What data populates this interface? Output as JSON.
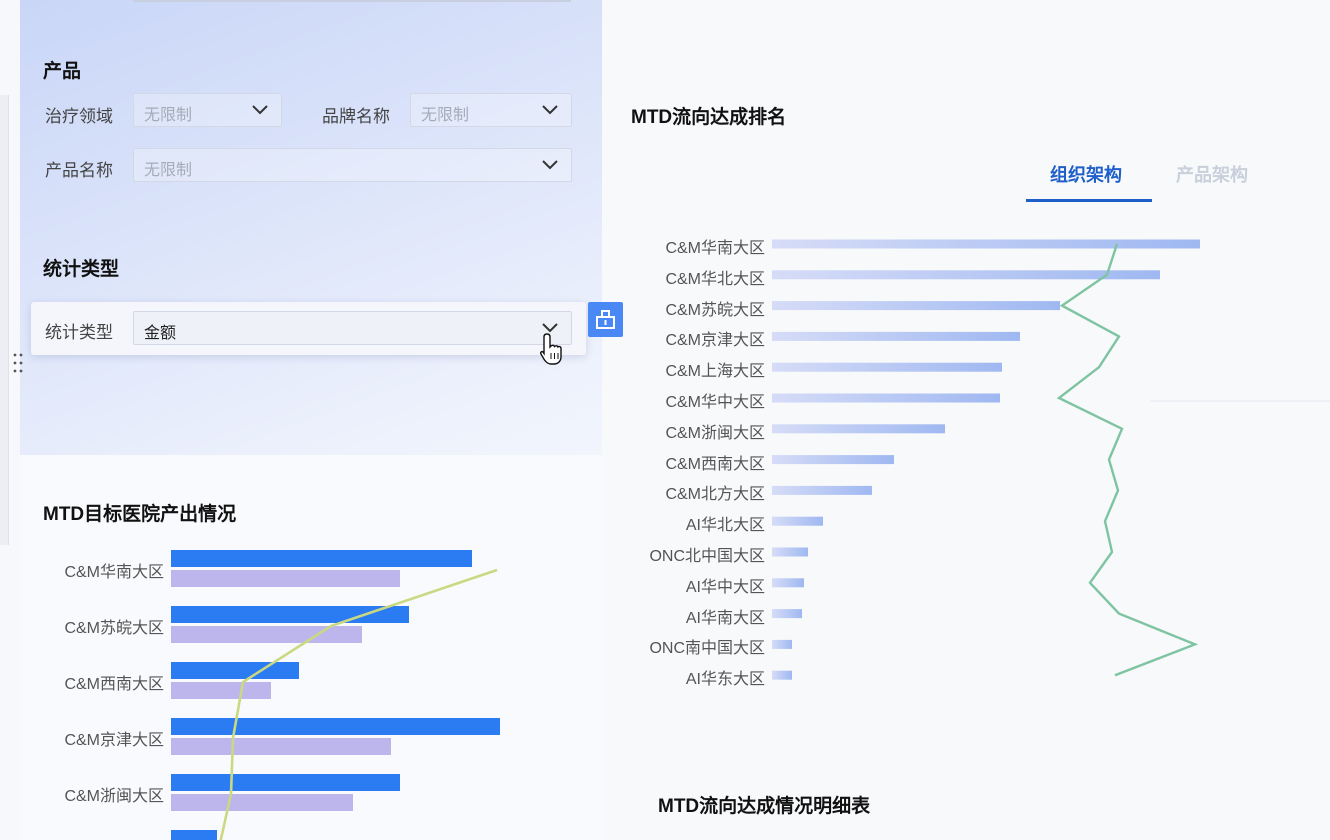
{
  "filters": {
    "product_section_title": "产品",
    "therapy_area": {
      "label": "治疗领域",
      "value": "无限制"
    },
    "brand_name": {
      "label": "品牌名称",
      "value": "无限制"
    },
    "product_name": {
      "label": "产品名称",
      "value": "无限制"
    },
    "stat_section_title": "统计类型",
    "stat_type": {
      "label": "统计类型",
      "value": "金额"
    }
  },
  "icons": {
    "dropdown": "chevron-down-icon",
    "side_button": "widget-icon",
    "drag": "drag-handle-icon",
    "cursor": "hand-pointer-icon"
  },
  "colors": {
    "accent": "#1f5fc9",
    "bar_primary": "#2b7bf2",
    "bar_secondary": "#bcb6ec",
    "rank_bar": "#a9bff3",
    "rank_line": "#7fc4a2",
    "hospital_line": "#cbd882"
  },
  "charts": {
    "hospital_title": "MTD目标医院产出情况",
    "ranking_title": "MTD流向达成排名",
    "detail_title": "MTD流向达成情况明细表",
    "tabs": [
      {
        "label": "组织架构",
        "active": true
      },
      {
        "label": "产品架构",
        "active": false
      }
    ]
  },
  "chart_data": [
    {
      "type": "bar",
      "title": "MTD流向达成排名",
      "orientation": "horizontal",
      "categories": [
        "C&M华南大区",
        "C&M华北大区",
        "C&M苏皖大区",
        "C&M京津大区",
        "C&M上海大区",
        "C&M华中大区",
        "C&M浙闽大区",
        "C&M西南大区",
        "C&M北方大区",
        "AI华北大区",
        "ONC北中国大区",
        "AI华中大区",
        "AI华南大区",
        "ONC南中国大区",
        "AI华东大区"
      ],
      "series": [
        {
          "values": [
            428,
            388,
            288,
            248,
            230,
            228,
            173,
            122,
            100,
            51,
            36,
            32,
            30,
            20,
            20
          ]
        },
        {
          "values": [
            345,
            335,
            290,
            347,
            327,
            287,
            350,
            337,
            346,
            333,
            340,
            318,
            347,
            423,
            343
          ]
        }
      ],
      "xlim": [
        0,
        460
      ]
    },
    {
      "type": "bar",
      "title": "MTD目标医院产出情况",
      "orientation": "horizontal",
      "categories": [
        "C&M华南大区",
        "C&M苏皖大区",
        "C&M西南大区",
        "C&M京津大区",
        "C&M浙闽大区"
      ],
      "series": [
        {
          "values": [
            301,
            238,
            128,
            329,
            229
          ]
        },
        {
          "values": [
            229,
            191,
            100,
            220,
            182
          ]
        },
        {
          "values": [
            326,
            160,
            72,
            62,
            60
          ]
        }
      ],
      "xlim": [
        0,
        360
      ]
    }
  ]
}
